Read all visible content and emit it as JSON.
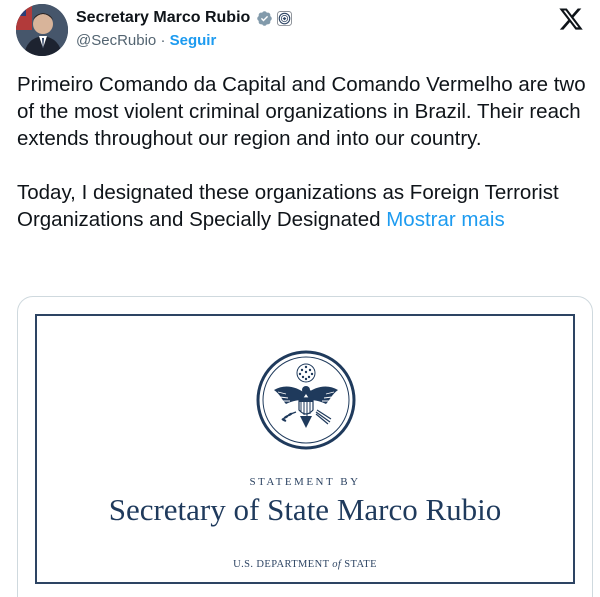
{
  "author": {
    "name": "Secretary Marco Rubio",
    "handle": "@SecRubio",
    "separator": "·",
    "follow_label": "Seguir"
  },
  "icons": {
    "verified": "verified-badge-icon",
    "affiliate": "state-department-seal-icon",
    "platform": "x-logo-icon"
  },
  "tweet": {
    "paragraph_1": "Primeiro Comando da Capital and Comando Vermelho are two of the most violent criminal organizations in Brazil. Their reach extends throughout our region and into our country.",
    "paragraph_2": "Today, I designated these organizations as Foreign Terrorist Organizations and Specially Designated",
    "show_more": "Mostrar mais"
  },
  "media": {
    "statement_by": "STATEMENT BY",
    "title": "Secretary of State Marco Rubio",
    "dept_prefix": "U.S. DEPARTMENT",
    "dept_of": "of",
    "dept_suffix": "STATE"
  },
  "colors": {
    "link": "#1d9bf0",
    "navy": "#2d4463",
    "text": "#0f1419",
    "muted": "#536471"
  }
}
